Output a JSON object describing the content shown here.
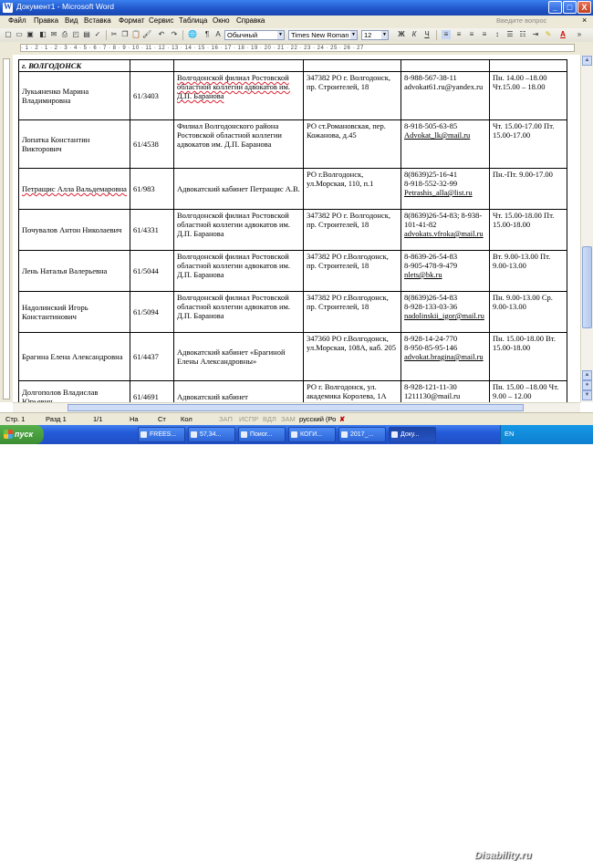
{
  "window": {
    "title": "Документ1 - Microsoft Word",
    "minimize": "_",
    "maximize": "□",
    "close": "X"
  },
  "menu": {
    "items": [
      "Файл",
      "Правка",
      "Вид",
      "Вставка",
      "Формат",
      "Сервис",
      "Таблица",
      "Окно",
      "Справка"
    ],
    "ask": "Введите вопрос",
    "close_doc": "×"
  },
  "toolbar": {
    "style": "Обычный",
    "font": "Times New Roman",
    "size": "12",
    "bold": "Ж",
    "italic": "К",
    "underline": "Ч",
    "font_color_letter": "A"
  },
  "ruler": {
    "marks": "· 1 · 2 · 1 · 2 · 3 · 4 · 5 · 6 · 7 · 8 · 9 · 10 · 11 · 12 · 13 · 14 · 15 · 16 · 17 · 18 · 19 · 20 · 21 · 22 · 23 · 24 · 25 · 26 · 27"
  },
  "table": {
    "city": "г. ВОЛГОДОНСК",
    "rows": [
      {
        "name": "Лукьяненко Марина Владимировна",
        "num": "61/3403",
        "org": "Волгодонской филиал Ростовской областной коллегии адвокатов им. Д.П. Баранова",
        "addr": "347382 РО г. Волгодонск, пр. Строителей, 18",
        "contact1": "8-988-567-38-11",
        "contact2": "advokat61.ru@yandex.ru",
        "contact3": "",
        "hours": "Пн. 14.00 –18.00 Чт.15.00 – 18.00"
      },
      {
        "name": "Лопатка Константин Викторович",
        "num": "61/4538",
        "org": "Филиал Волгодонского района Ростовской областной коллегии адвокатов им. Д.П. Баранова",
        "addr": "РО ст.Романовская, пер. Кожанова, д.45",
        "contact1": "8-918-505-63-85",
        "contact2": "Advokat_lk@mail.ru",
        "contact3": "",
        "hours": "Чт. 15.00-17.00 Пт. 15.00-17.00"
      },
      {
        "name": "Петращис Алла Вальдемаровна",
        "num": "61/983",
        "org": "Адвокатский кабинет Петращис А.В.",
        "addr": "РО г.Волгодонск, ул.Морская, 110, п.1",
        "contact1": "8(8639)25-16-41",
        "contact2": "8-918-552-32-99",
        "contact3": "Petrashis_alla@list.ru",
        "hours": "Пн.-Пт. 9.00-17.00"
      },
      {
        "name": "Почувалов Антон Николаевич",
        "num": "61/4331",
        "org": "Волгодонской филиал Ростовской областной коллегии адвокатов им. Д.П. Баранова",
        "addr": "347382 РО г. Волгодонск, пр. Строителей, 18",
        "contact1": "8(8639)26-54-83; 8-938-101-41-82",
        "contact2": "advokats.vfroka@mail.ru",
        "contact3": "",
        "hours": "Чт. 15.00-18.00 Пт. 15.00-18.00"
      },
      {
        "name": "Лень Наталья Валерьевна",
        "num": "61/5044",
        "org": "Волгодонской филиал Ростовской областной коллегии адвокатов им. Д.П. Баранова",
        "addr": "347382 РО г.Волгодонск, пр. Строителей, 18",
        "contact1": "8-8639-26-54-83",
        "contact2": "8-905-478-9-479",
        "contact3": "nlets@bk.ru",
        "hours": "Вт. 9.00-13.00 Пт. 9.00-13.00"
      },
      {
        "name": "Надолинский Игорь Константинович",
        "num": "61/5094",
        "org": "Волгодонской филиал Ростовской областной коллегии адвокатов им. Д.П. Баранова",
        "addr": "347382 РО г.Волгодонск, пр. Строителей, 18",
        "contact1": "8(8639)26-54-83",
        "contact2": "8-928-133-03-36",
        "contact3": "nadolinskii_igor@mail.ru",
        "hours": "Пн. 9.00-13.00 Ср. 9.00-13.00"
      },
      {
        "name": "Брагина Елена Александровна",
        "num": "61/4437",
        "org": "Адвокатский кабинет «Брагиной Елены Александровны»",
        "addr": "347360 РО г.Волгодонск, ул.Морская, 108А, каб. 205",
        "contact1": "8-928-14-24-770",
        "contact2": "8-950-85-95-146",
        "contact3": "advokat.bragina@mail.ru",
        "hours": "Пн. 15.00-18.00 Вт. 15.00-18.00"
      },
      {
        "name": "Долгополов Владислав Юрьевич",
        "num": "61/4691",
        "org": "Адвокатский кабинет",
        "addr": "РО г. Волгодонск, ул. академика Королева, 1А",
        "contact1": "8-928-121-11-30",
        "contact2": "1211130@mail.ru",
        "contact3": "",
        "hours": "Пн. 15.00 –18.00 Чт. 9.00 – 12.00"
      }
    ]
  },
  "status": {
    "page": "Стр. 1",
    "section": "Разд 1",
    "pages": "1/1",
    "at": "На",
    "line": "Ст",
    "col": "Кол",
    "rec": "ЗАП",
    "trk": "ИСПР",
    "ext": "ВДЛ",
    "ovr": "ЗАМ",
    "lang": "русский (Ро"
  },
  "taskbar": {
    "start": "пуск",
    "tasks": [
      "FREES...",
      "57,34...",
      "Поиог...",
      "КОГИ...",
      "2017_...",
      "Доку..."
    ],
    "lang": "EN",
    "watermark": "Disability.ru"
  }
}
